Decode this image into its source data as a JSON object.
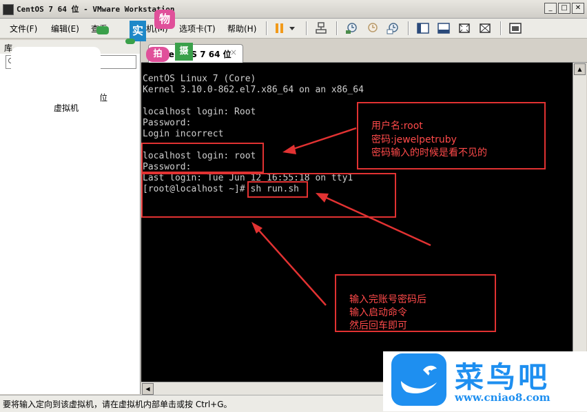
{
  "window": {
    "title": "CentOS 7 64 位 - VMware Workstation",
    "min_icon": "minimize-icon",
    "max_icon": "maximize-icon",
    "close_icon": "close-icon"
  },
  "menu": {
    "file": "文件(F)",
    "edit": "编辑(E)",
    "view": "查看",
    "vm": "机(M)",
    "tabs": "选项卡(T)",
    "help": "帮助(H)"
  },
  "toolbar": {
    "icons": [
      "pause-icon",
      "dropdown-arrow-icon",
      "network-icon",
      "snapshot-icon",
      "revert-snapshot-icon",
      "snapshot-manager-icon",
      "show-library-icon",
      "thumbnail-bar-icon",
      "fullscreen-icon",
      "unity-icon",
      "console-view-icon"
    ]
  },
  "sidebar": {
    "header": "库",
    "item_partial": "位",
    "vm_label": "虚拟机"
  },
  "tab": {
    "label": "CentOS 7 64 位",
    "close": "×"
  },
  "console": {
    "lines": [
      "CentOS Linux 7 (Core)",
      "Kernel 3.10.0-862.el7.x86_64 on an x86_64",
      "",
      "localhost login: Root",
      "Password:",
      "Login incorrect",
      "",
      "localhost login: root",
      "Password:",
      "Last login: Tue Jun 12 16:55:18 on tty1",
      "[root@localhost ~]# sh run.sh"
    ]
  },
  "annotations": {
    "note1": [
      "用户名:root",
      "密码:jewelpetruby",
      "密码输入的时候是看不见的"
    ],
    "note2": [
      "输入完账号密码后",
      "输入启动命令",
      "然后回车即可"
    ],
    "color": "#e23232"
  },
  "statusbar": {
    "text": "要将输入定向到该虚拟机，请在虚拟机内部单击或按 Ctrl+G。"
  },
  "logo": {
    "name": "菜鸟吧",
    "url": "www.cniao8.com",
    "color": "#1e8ff0"
  },
  "watermark": {
    "chars": [
      "实",
      "物",
      "拍",
      "摄"
    ]
  }
}
